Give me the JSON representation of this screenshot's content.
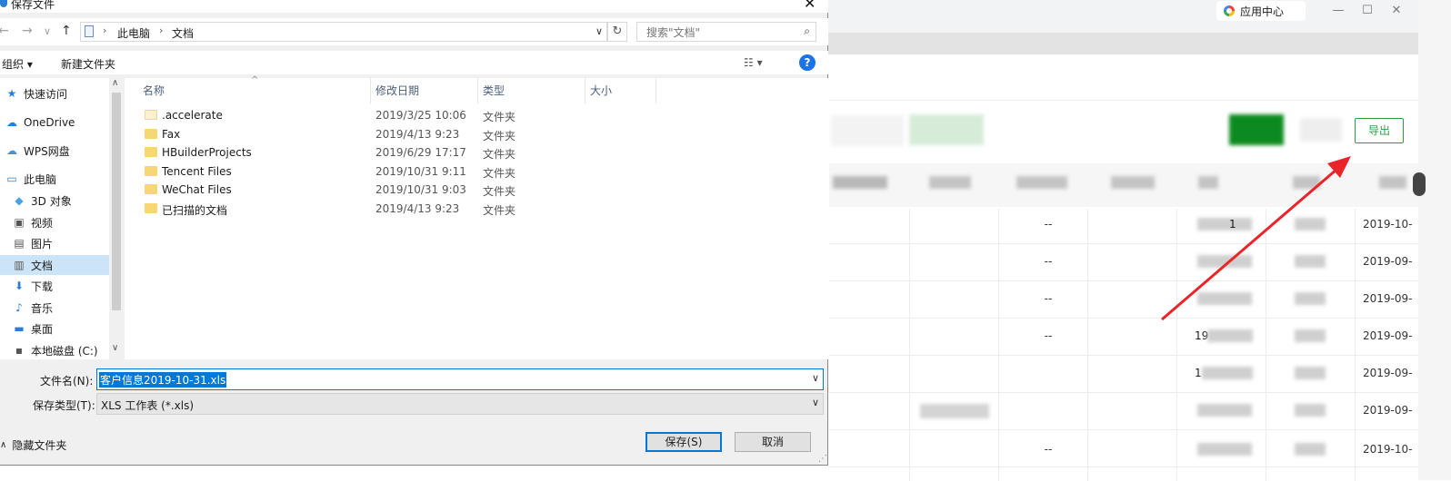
{
  "background_app": {
    "app_center_label": "应用中心",
    "export_label": "导出",
    "dash": "--",
    "dates": [
      "2019-10-",
      "2019-09-",
      "2019-09-",
      "2019-09-",
      "2019-09-",
      "2019-09-",
      "2019-10-"
    ],
    "partial_values": [
      "1",
      "19",
      "1"
    ],
    "window_controls": [
      "—",
      "☐",
      "✕"
    ]
  },
  "dialog": {
    "title": "保存文件",
    "close_glyph": "✕",
    "nav": {
      "back": "←",
      "forward": "→",
      "recent": "∨",
      "up": "↑"
    },
    "address": {
      "root": "此电脑",
      "folder": "文档",
      "sep": "›"
    },
    "search_placeholder": "搜索\"文档\"",
    "toolbar": {
      "organize": "组织 ▾",
      "new_folder": "新建文件夹",
      "view": "☷ ▾",
      "help": "?"
    },
    "nav_pane": [
      {
        "label": "快速访问",
        "icon": "star-icon",
        "glyph": "★",
        "color": "#2a7fd4"
      },
      {
        "label": "OneDrive",
        "icon": "cloud-icon",
        "glyph": "☁",
        "color": "#2a7fd4"
      },
      {
        "label": "WPS网盘",
        "icon": "cloud-outline-icon",
        "glyph": "☁",
        "color": "#4a90d9"
      },
      {
        "label": "此电脑",
        "icon": "computer-icon",
        "glyph": "▭",
        "color": "#2a7fd4"
      },
      {
        "label": "3D 对象",
        "icon": "cube-icon",
        "glyph": "◆",
        "color": "#4aa3e0"
      },
      {
        "label": "视频",
        "icon": "video-icon",
        "glyph": "▣",
        "color": "#555"
      },
      {
        "label": "图片",
        "icon": "picture-icon",
        "glyph": "▤",
        "color": "#555"
      },
      {
        "label": "文档",
        "icon": "document-icon",
        "glyph": "▥",
        "color": "#555"
      },
      {
        "label": "下载",
        "icon": "download-icon",
        "glyph": "⬇",
        "color": "#2a7fd4"
      },
      {
        "label": "音乐",
        "icon": "music-icon",
        "glyph": "♪",
        "color": "#2a7fd4"
      },
      {
        "label": "桌面",
        "icon": "desktop-icon",
        "glyph": "▬",
        "color": "#2a7fd4"
      },
      {
        "label": "本地磁盘 (C:)",
        "icon": "drive-icon",
        "glyph": "▪",
        "color": "#555"
      }
    ],
    "columns": {
      "name": "名称",
      "date": "修改日期",
      "type": "类型",
      "size": "大小"
    },
    "files": [
      {
        "name": ".accelerate",
        "date": "2019/3/25 10:06",
        "type": "文件夹"
      },
      {
        "name": "Fax",
        "date": "2019/4/13 9:23",
        "type": "文件夹"
      },
      {
        "name": "HBuilderProjects",
        "date": "2019/6/29 17:17",
        "type": "文件夹"
      },
      {
        "name": "Tencent Files",
        "date": "2019/10/31 9:11",
        "type": "文件夹"
      },
      {
        "name": "WeChat Files",
        "date": "2019/10/31 9:03",
        "type": "文件夹"
      },
      {
        "name": "已扫描的文档",
        "date": "2019/4/13 9:23",
        "type": "文件夹"
      }
    ],
    "filename_label": "文件名(N):",
    "filename_value": "客户信息2019-10-31.xls",
    "filetype_label": "保存类型(T):",
    "filetype_value": "XLS 工作表 (*.xls)",
    "hide_folders": "隐藏文件夹",
    "save_label": "保存(S)",
    "cancel_label": "取消"
  },
  "colors": {
    "accent": "#0078d7",
    "export_green": "#2e9b47",
    "arrow_red": "#e8262a"
  }
}
